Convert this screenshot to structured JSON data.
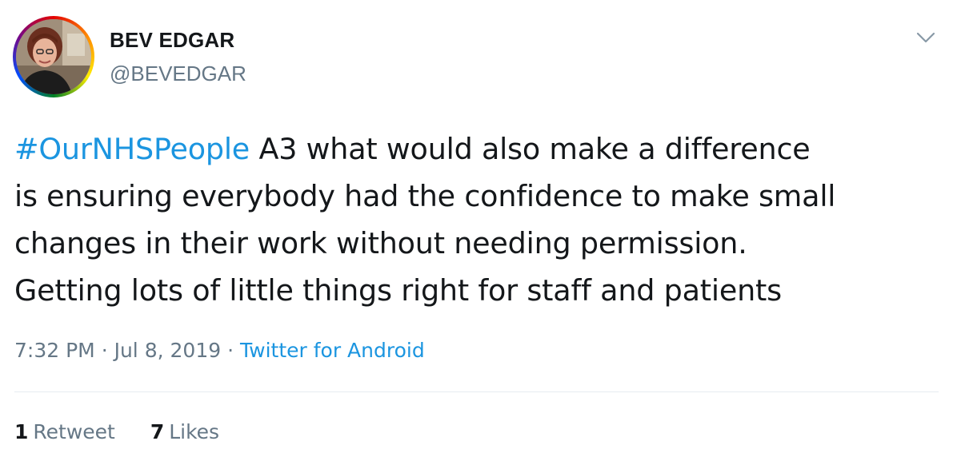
{
  "author": {
    "display_name": "BEV EDGAR",
    "handle": "@BEVEDGAR"
  },
  "menu_icon": "chevron-down-icon",
  "tweet": {
    "hashtag": "#OurNHSPeople",
    "lines": [
      " A3 what would also make a difference",
      "is ensuring everybody had the confidence to make small",
      "changes in their work without needing permission.",
      "Getting lots of little things right for staff and patients"
    ]
  },
  "meta": {
    "time": "7:32 PM",
    "separator": "·",
    "date": "Jul 8, 2019",
    "source": "Twitter for Android"
  },
  "stats": {
    "retweets_count": "1",
    "retweets_label": "Retweet",
    "likes_count": "7",
    "likes_label": "Likes"
  },
  "colors": {
    "link": "#1b95e0",
    "secondary_text": "#657786",
    "primary_text": "#14171a",
    "divider": "#e6ecf0"
  }
}
